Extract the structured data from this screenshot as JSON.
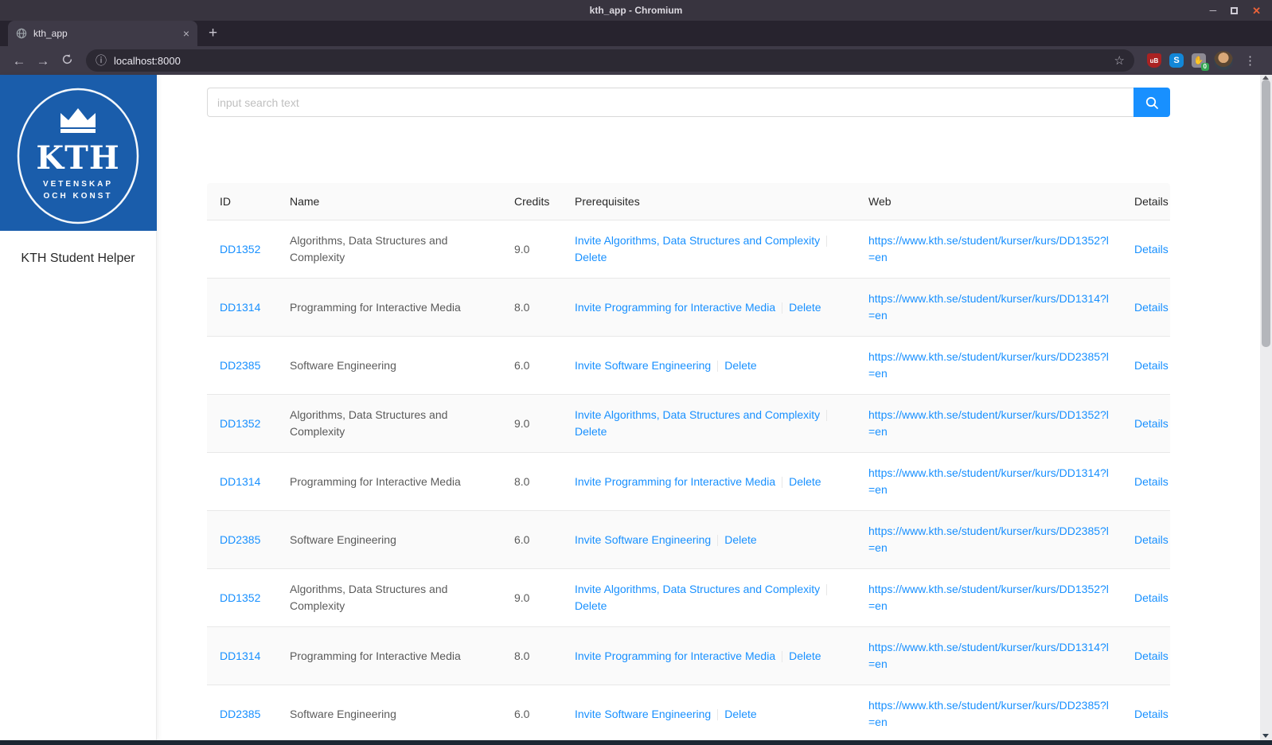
{
  "chrome": {
    "window_title": "kth_app - Chromium",
    "tab_title": "kth_app",
    "new_tab_label": "+",
    "url": "localhost:8000",
    "extension_badge": "0"
  },
  "sidebar": {
    "logo": {
      "kth": "KTH",
      "motto1": "VETENSKAP",
      "motto2": "OCH KONST"
    },
    "title": "KTH Student Helper"
  },
  "search": {
    "placeholder": "input search text"
  },
  "table": {
    "headers": {
      "id": "ID",
      "name": "Name",
      "credits": "Credits",
      "prerequisites": "Prerequisites",
      "web": "Web",
      "details": "Details"
    },
    "delete_label": "Delete",
    "details_label": "Details",
    "rows": [
      {
        "id": "DD1352",
        "name": "Algorithms, Data Structures and Complexity",
        "credits": "9.0",
        "invite": "Invite Algorithms, Data Structures and Complexity",
        "web": "https://www.kth.se/student/kurser/kurs/DD1352?l=en"
      },
      {
        "id": "DD1314",
        "name": "Programming for Interactive Media",
        "credits": "8.0",
        "invite": "Invite Programming for Interactive Media",
        "web": "https://www.kth.se/student/kurser/kurs/DD1314?l=en"
      },
      {
        "id": "DD2385",
        "name": "Software Engineering",
        "credits": "6.0",
        "invite": "Invite Software Engineering",
        "web": "https://www.kth.se/student/kurser/kurs/DD2385?l=en"
      },
      {
        "id": "DD1352",
        "name": "Algorithms, Data Structures and Complexity",
        "credits": "9.0",
        "invite": "Invite Algorithms, Data Structures and Complexity",
        "web": "https://www.kth.se/student/kurser/kurs/DD1352?l=en"
      },
      {
        "id": "DD1314",
        "name": "Programming for Interactive Media",
        "credits": "8.0",
        "invite": "Invite Programming for Interactive Media",
        "web": "https://www.kth.se/student/kurser/kurs/DD1314?l=en"
      },
      {
        "id": "DD2385",
        "name": "Software Engineering",
        "credits": "6.0",
        "invite": "Invite Software Engineering",
        "web": "https://www.kth.se/student/kurser/kurs/DD2385?l=en"
      },
      {
        "id": "DD1352",
        "name": "Algorithms, Data Structures and Complexity",
        "credits": "9.0",
        "invite": "Invite Algorithms, Data Structures and Complexity",
        "web": "https://www.kth.se/student/kurser/kurs/DD1352?l=en"
      },
      {
        "id": "DD1314",
        "name": "Programming for Interactive Media",
        "credits": "8.0",
        "invite": "Invite Programming for Interactive Media",
        "web": "https://www.kth.se/student/kurser/kurs/DD1314?l=en"
      },
      {
        "id": "DD2385",
        "name": "Software Engineering",
        "credits": "6.0",
        "invite": "Invite Software Engineering",
        "web": "https://www.kth.se/student/kurser/kurs/DD2385?l=en"
      }
    ]
  },
  "colors": {
    "accent": "#1890ff",
    "kth_blue": "#1a5dab",
    "link": "#1890ff",
    "header_bg": "#fafafa",
    "row_border": "#e8e8e8"
  }
}
